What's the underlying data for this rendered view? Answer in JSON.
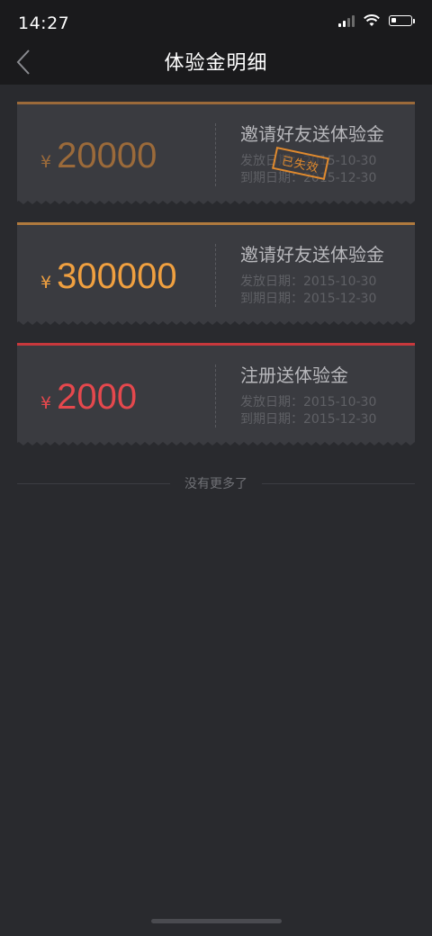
{
  "status_bar": {
    "time": "14:27"
  },
  "nav": {
    "title": "体验金明细",
    "back_icon": "chevron-left-icon"
  },
  "colors": {
    "expired": "#9b6a3a",
    "active": "#f0a040",
    "register": "#e5484d",
    "stamp": "#e08a2e"
  },
  "cards": [
    {
      "currency": "¥",
      "amount": "20000",
      "name": "邀请好友送体验金",
      "issue_date": "发放日期：2015-10-30",
      "expire_date": "到期日期：2015-12-30",
      "stamp": "已失效"
    },
    {
      "currency": "¥",
      "amount": "300000",
      "name": "邀请好友送体验金",
      "issue_date": "发放日期：2015-10-30",
      "expire_date": "到期日期：2015-12-30"
    },
    {
      "currency": "¥",
      "amount": "2000",
      "name": "注册送体验金",
      "issue_date": "发放日期：2015-10-30",
      "expire_date": "到期日期：2015-12-30"
    }
  ],
  "end_text": "没有更多了"
}
